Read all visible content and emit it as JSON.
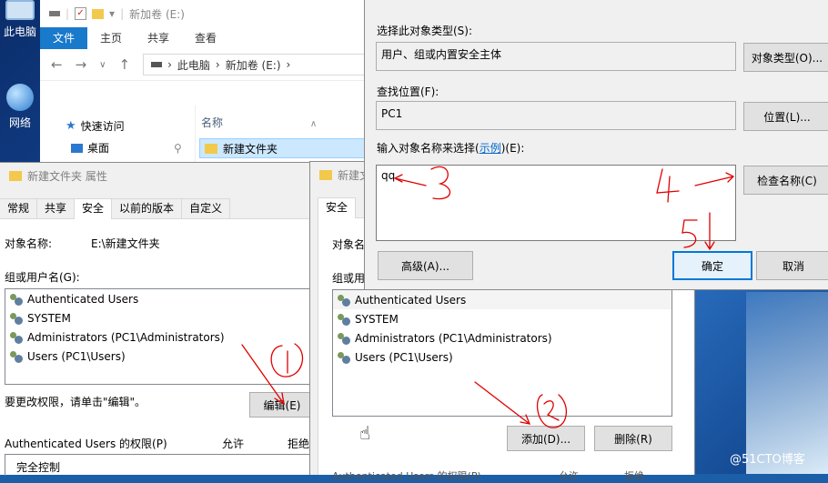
{
  "desktop": {
    "icons": [
      {
        "label": "此电脑"
      },
      {
        "label": "网络"
      }
    ],
    "watermark": "@51CTO博客"
  },
  "explorer": {
    "title": "新加卷 (E:)",
    "ribbon_tabs": [
      "文件",
      "主页",
      "共享",
      "查看"
    ],
    "path": [
      "此电脑",
      "新加卷 (E:)"
    ],
    "nav": [
      "快速访问",
      "桌面"
    ],
    "column_name": "名称",
    "folder": "新建文件夹"
  },
  "props": {
    "title": "新建文件夹 属性",
    "tabs": [
      "常规",
      "共享",
      "安全",
      "以前的版本",
      "自定义"
    ],
    "object_label": "对象名称:",
    "object_value": "E:\\新建文件夹",
    "groups_label": "组或用户名(G):",
    "users": [
      "Authenticated Users",
      "SYSTEM",
      "Administrators (PC1\\Administrators)",
      "Users (PC1\\Users)"
    ],
    "change_hint": "要更改权限，请单击\"编辑\"。",
    "edit_button": "编辑(E)",
    "perm_label": "Authenticated Users 的权限(P)",
    "allow": "允许",
    "deny": "拒绝",
    "perm_row": "完全控制"
  },
  "perm_dialog": {
    "title": "新建文件夹",
    "tab": "安全",
    "object_label": "对象名",
    "groups_label": "组或用",
    "users": [
      "Authenticated Users",
      "SYSTEM",
      "Administrators (PC1\\Administrators)",
      "Users (PC1\\Users)"
    ],
    "add_button": "添加(D)...",
    "remove_button": "删除(R)",
    "perm_label": "Authenticated Users 的权限(P)",
    "allow": "允许",
    "deny": "拒绝"
  },
  "select_dialog": {
    "type_label": "选择此对象类型(S):",
    "type_value": "用户、组或内置安全主体",
    "type_button": "对象类型(O)...",
    "location_label": "查找位置(F):",
    "location_value": "PC1",
    "location_button": "位置(L)...",
    "names_label_prefix": "输入对象名称来选择(",
    "names_label_link": "示例",
    "names_label_suffix": ")(E):",
    "names_value": "qq",
    "check_button": "检查名称(C)",
    "advanced_button": "高级(A)...",
    "ok_button": "确定",
    "cancel_button": "取消"
  },
  "annotations": {
    "colors": {
      "ink": "#e00000"
    }
  }
}
